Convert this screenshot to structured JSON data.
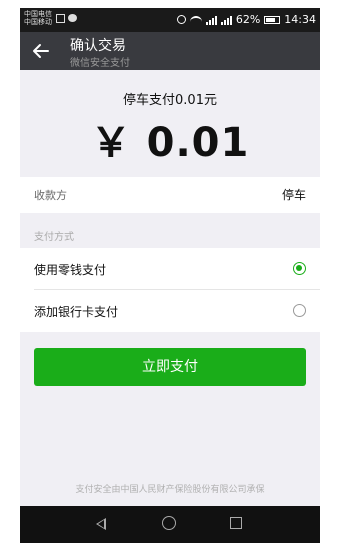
{
  "status_bar": {
    "carrier_line1": "中国电信",
    "carrier_line2": "中国移动",
    "battery": "62%",
    "time": "14:34"
  },
  "header": {
    "title": "确认交易",
    "subtitle": "微信安全支付"
  },
  "payment": {
    "title": "停车支付0.01元",
    "amount": "￥ 0.01"
  },
  "payee": {
    "label": "收款方",
    "value": "停车"
  },
  "methods": {
    "section_title": "支付方式",
    "items": [
      {
        "label": "使用零钱支付",
        "selected": true
      },
      {
        "label": "添加银行卡支付",
        "selected": false
      }
    ]
  },
  "actions": {
    "pay_now": "立即支付"
  },
  "footer": {
    "note": "支付安全由中国人民财产保险股份有限公司承保"
  },
  "colors": {
    "accent": "#1aad19",
    "titlebar": "#393a3f",
    "background": "#f0eff4"
  }
}
